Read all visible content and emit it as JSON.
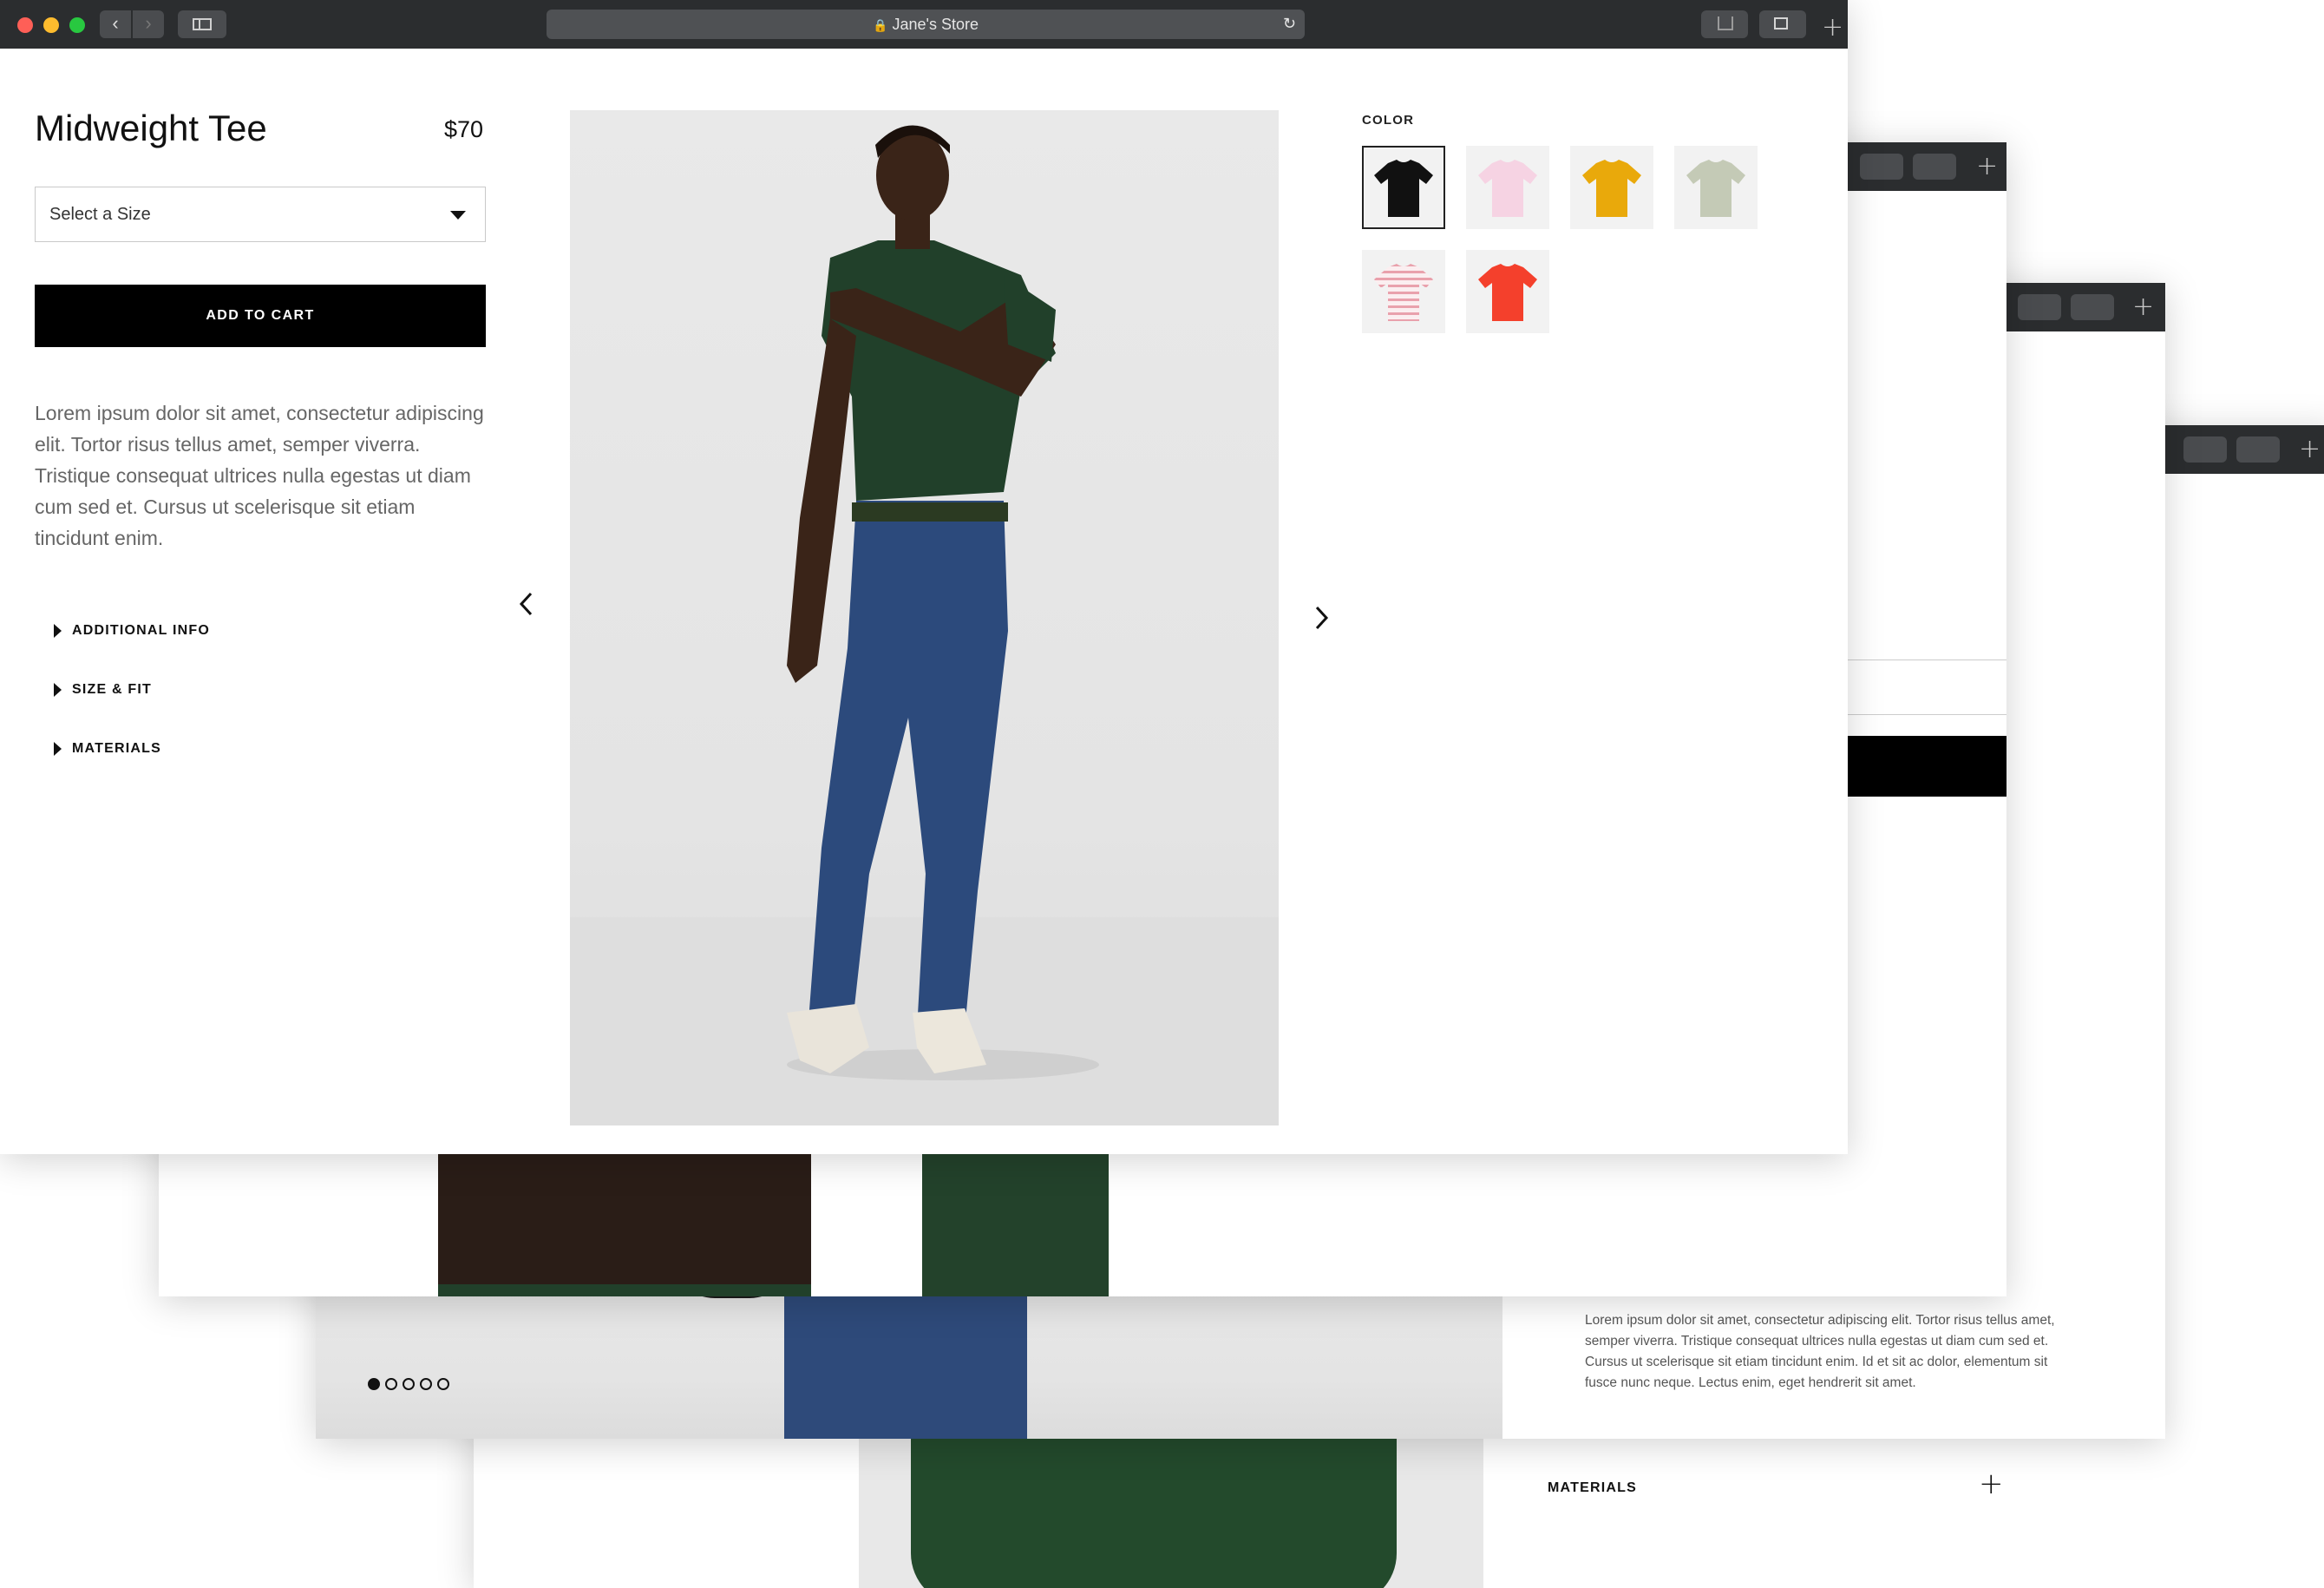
{
  "browser": {
    "address": "Jane's Store",
    "lock_icon": "lock-icon",
    "reload_icon": "reload-icon"
  },
  "product": {
    "title": "Midweight Tee",
    "price": "$70",
    "size_select": "Select a Size",
    "add_to_cart": "ADD TO CART",
    "description": "Lorem ipsum dolor sit amet, consectetur adipiscing elit. Tortor risus tellus amet, semper viverra. Tristique consequat ultrices nulla egestas ut diam cum sed et. Cursus ut scelerisque sit etiam tincidunt enim.",
    "accordion": [
      "ADDITIONAL INFO",
      "SIZE & FIT",
      "MATERIALS"
    ],
    "color_label": "COLOR",
    "colors": [
      {
        "name": "black",
        "hex": "#111111",
        "selected": true
      },
      {
        "name": "pink",
        "hex": "#f6d3e3",
        "selected": false
      },
      {
        "name": "yellow",
        "hex": "#e9a90b",
        "selected": false
      },
      {
        "name": "sage",
        "hex": "#c4cab6",
        "selected": false
      },
      {
        "name": "striped",
        "hex": "#e9a1ac",
        "selected": false
      },
      {
        "name": "red",
        "hex": "#f4402c",
        "selected": false
      }
    ]
  },
  "back_window": {
    "description": "Lorem ipsum dolor sit amet, consectetur adipiscing elit. Tortor risus tellus amet, semper viverra. Tristique consequat ultrices nulla egestas ut diam cum sed et. Cursus ut scelerisque sit etiam tincidunt enim. Id et sit ac dolor, elementum sit fusce nunc neque. Lectus enim, eget hendrerit sit amet.",
    "materials": "MATERIALS",
    "carousel_dots": 5,
    "active_dot": 1
  }
}
